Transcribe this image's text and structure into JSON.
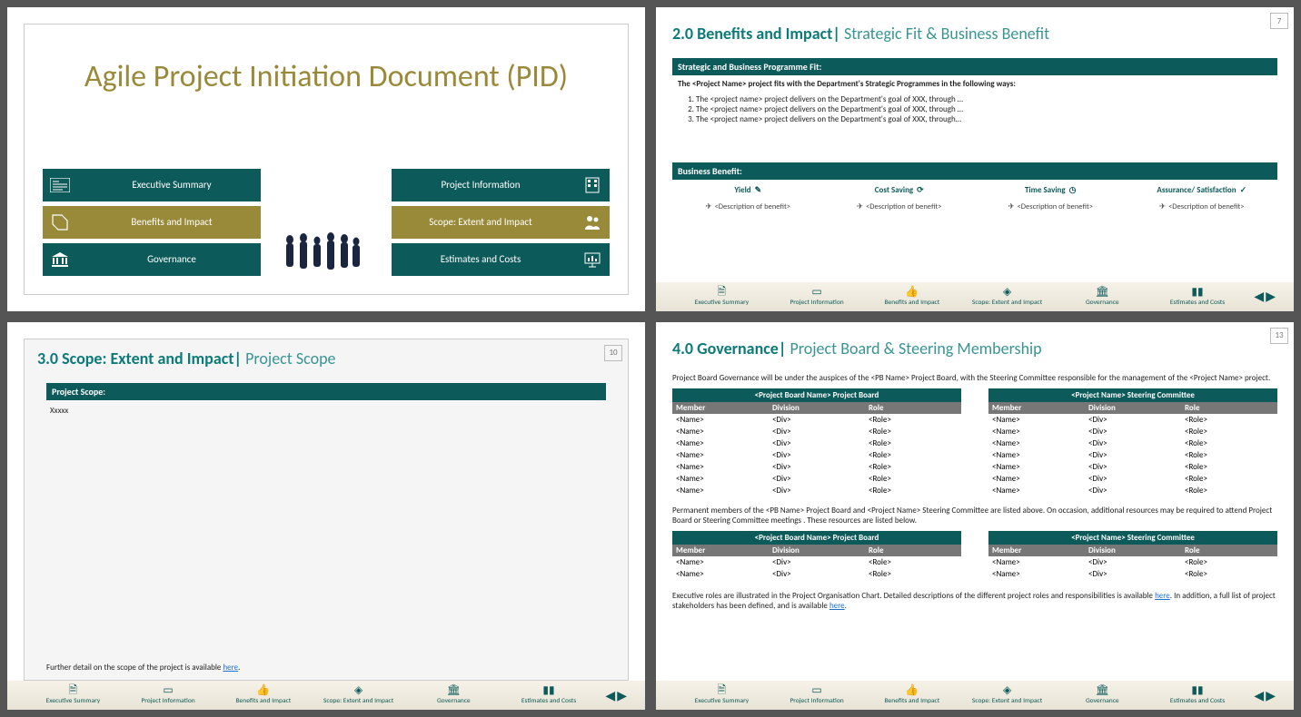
{
  "slide1": {
    "title": "Agile Project Initiation Document (PID)",
    "left_menu": [
      {
        "label": "Executive Summary",
        "cls": "teal"
      },
      {
        "label": "Benefits and Impact",
        "cls": "olive"
      },
      {
        "label": "Governance",
        "cls": "teal"
      }
    ],
    "right_menu": [
      {
        "label": "Project Information",
        "cls": "teal"
      },
      {
        "label": "Scope: Extent and Impact",
        "cls": "olive"
      },
      {
        "label": "Estimates and Costs",
        "cls": "teal"
      }
    ]
  },
  "slide2": {
    "page": "7",
    "heading_bold": "2.0 Benefits and Impact",
    "heading_sub": "Strategic Fit & Business Benefit",
    "bar1": "Strategic and Business Programme Fit:",
    "intro": "The <Project Name> project fits with the Department's Strategic Programmes in the following ways:",
    "bullets": [
      "The <project name> project delivers on the Department's goal of XXX, through …",
      "The <project name> project delivers on the Department's goal of XXX, through …",
      "The <project name> project delivers on the Department's goal of XXX, through…"
    ],
    "bar2": "Business Benefit:",
    "benefits": [
      {
        "name": "Yield",
        "desc": "<Description of benefit>"
      },
      {
        "name": "Cost Saving",
        "desc": "<Description of benefit>"
      },
      {
        "name": "Time Saving",
        "desc": "<Description of benefit>"
      },
      {
        "name": "Assurance/ Satisfaction",
        "desc": "<Description of benefit>"
      }
    ]
  },
  "slide3": {
    "page": "10",
    "heading_bold": "3.0 Scope: Extent and Impact",
    "heading_sub": "Project Scope",
    "bar": "Project Scope:",
    "body": "Xxxxx",
    "footer_pre": "Further detail on the scope of the project is available ",
    "footer_link": "here",
    "footer_post": "."
  },
  "slide4": {
    "page": "13",
    "heading_bold": "4.0 Governance",
    "heading_sub": "Project Board & Steering Membership",
    "intro": "Project Board Governance will be under the auspices of the <PB Name> Project Board, with the Steering Committee responsible for the management of the <Project Name> project.",
    "table1_title": "<Project Board Name> Project Board",
    "table2_title": "<Project Name> Steering Committee",
    "cols": {
      "c1": "Member",
      "c2": "Division",
      "c3": "Role"
    },
    "row": {
      "c1": "<Name>",
      "c2": "<Div>",
      "c3": "<Role>"
    },
    "mid_text": "Permanent members of the <PB Name> Project Board and <Project Name> Steering Committee are listed above. On occasion, additional resources may be required to attend Project Board or Steering Committee meetings . These resources are listed below.",
    "foot_pre": "Executive roles are illustrated in the Project Organisation Chart. Detailed descriptions of the different project roles and responsibilities is available ",
    "foot_link": "here",
    "foot_mid": ". In addition, a full list of project stakeholders has been defined, and is available ",
    "foot_link2": "here",
    "foot_post": "."
  },
  "footer_nav": [
    "Executive Summary",
    "Project Information",
    "Benefits and Impact",
    "Scope: Extent and Impact",
    "Governance",
    "Estimates and Costs"
  ]
}
